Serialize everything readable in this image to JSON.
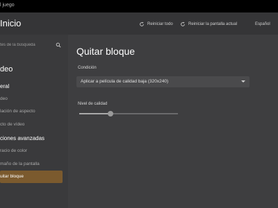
{
  "window": {
    "title": "l juego"
  },
  "header": {
    "home_label": "Inicio",
    "reset_all_label": "Reiniciar todo",
    "reset_screen_label": "Reiniciar la pantalla actual",
    "language_label": "Español"
  },
  "sidebar": {
    "search_placeholder": "tes de la búsqueda",
    "section_label": "deo",
    "groups": [
      {
        "label": "eral",
        "items": [
          "deo",
          "lación de aspecto",
          "cto de vídeo"
        ]
      },
      {
        "label": "ciones avanzadas",
        "items": [
          "racio de color",
          "maño de la pantalla",
          "uitar bloque"
        ]
      }
    ],
    "active_item": "uitar bloque"
  },
  "main": {
    "title": "Quitar bloque",
    "condition_label": "Condición",
    "condition_value": "Aplicar a película de calidad baja (320x240)",
    "quality_label": "Nivel de calidad",
    "quality_level": 0.32
  },
  "colors": {
    "background": "#3e3e40",
    "sidebar": "#3a3a3c",
    "accent": "#7b5a2e"
  },
  "icons": {
    "reset_all": "rotate-icon",
    "reset_screen": "rotate-icon",
    "search": "search-icon",
    "dropdown": "chevron-down-icon"
  }
}
